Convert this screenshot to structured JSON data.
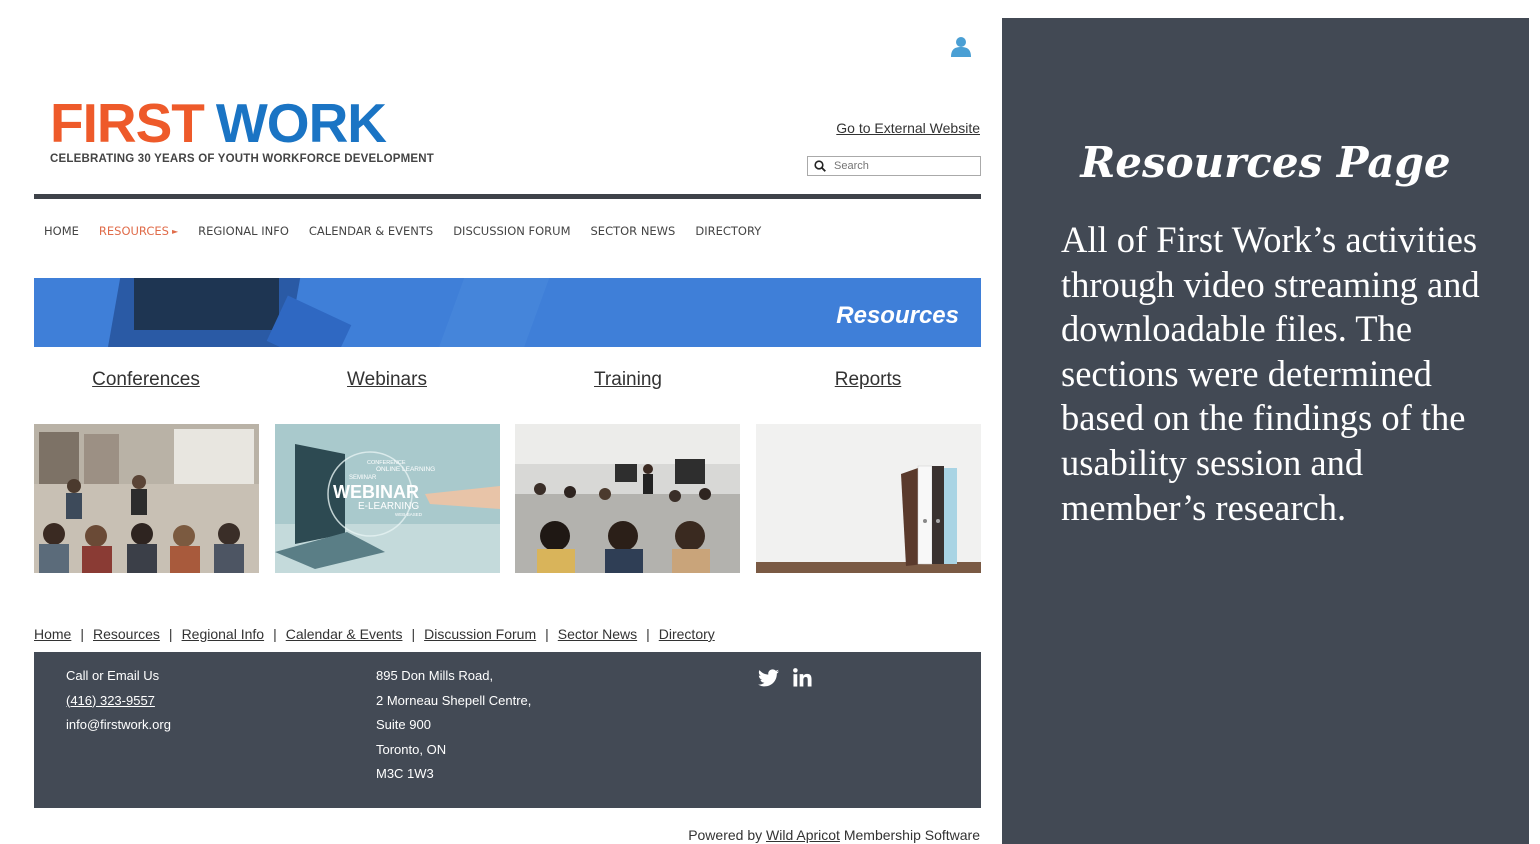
{
  "header": {
    "logo_first": "FIRST",
    "logo_work": "WORK",
    "tagline": "CELEBRATING 30 YEARS OF YOUTH WORKFORCE DEVELOPMENT",
    "external_link": "Go to External Website",
    "search_placeholder": "Search",
    "user_icon": "user-icon"
  },
  "nav": {
    "items": [
      {
        "label": "HOME"
      },
      {
        "label": "RESOURCES"
      },
      {
        "label": "REGIONAL INFO"
      },
      {
        "label": "CALENDAR & EVENTS"
      },
      {
        "label": "DISCUSSION FORUM"
      },
      {
        "label": "SECTOR NEWS"
      },
      {
        "label": "DIRECTORY"
      }
    ],
    "active_arrow": "►"
  },
  "banner": {
    "title": "Resources"
  },
  "categories": [
    {
      "label": "Conferences"
    },
    {
      "label": "Webinars"
    },
    {
      "label": "Training"
    },
    {
      "label": "Reports"
    }
  ],
  "webinar_image_text": {
    "line1": "CONFERENCE",
    "line2": "ONLINE LEARNING",
    "line3": "SEMINAR",
    "line4": "WEBINAR",
    "line5": "E-LEARNING",
    "line6": "WEB-BASED"
  },
  "footer_links": [
    {
      "label": "Home"
    },
    {
      "label": "Resources"
    },
    {
      "label": "Regional Info"
    },
    {
      "label": "Calendar & Events"
    },
    {
      "label": "Discussion Forum"
    },
    {
      "label": "Sector News"
    },
    {
      "label": "Directory"
    }
  ],
  "footer": {
    "contact_heading": "Call or Email Us",
    "phone": "(416) 323-9557",
    "email": "info@firstwork.org",
    "address": [
      "895 Don Mills Road,",
      "2 Morneau Shepell Centre,",
      "Suite 900",
      "Toronto, ON",
      "M3C 1W3"
    ],
    "social_icons": [
      "twitter-icon",
      "linkedin-icon"
    ]
  },
  "powered": {
    "prefix": "Powered by ",
    "link": "Wild Apricot",
    "suffix": " Membership Software"
  },
  "panel": {
    "title": "Resources Page",
    "body": "All of First Work’s activities through video streaming and downloadable files. The sections were determined based on the findings of the usability session and member’s research."
  },
  "colors": {
    "logo_orange": "#ee5a2a",
    "logo_blue": "#1a74c4",
    "nav_active": "#e06c4a",
    "banner_blue": "#3f7fd8",
    "footer_dark": "#434a55",
    "panel_dark": "#424954",
    "user_icon": "#4a9fd4"
  }
}
